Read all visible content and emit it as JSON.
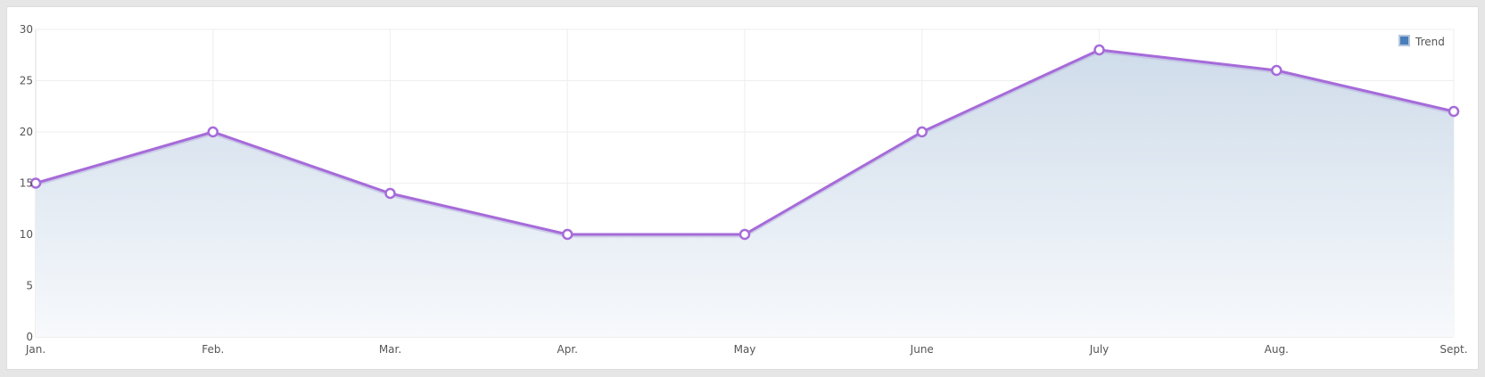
{
  "chart_data": {
    "type": "area",
    "categories": [
      "Jan.",
      "Feb.",
      "Mar.",
      "Apr.",
      "May",
      "June",
      "July",
      "Aug.",
      "Sept."
    ],
    "series": [
      {
        "name": "Trend",
        "values": [
          15,
          20,
          14,
          10,
          10,
          20,
          28,
          26,
          22
        ]
      }
    ],
    "yticks": [
      0,
      5,
      10,
      15,
      20,
      25,
      30
    ],
    "ylim": [
      0,
      30
    ],
    "grid": true,
    "legend": "top-right",
    "colors": {
      "line": "#a66bd9",
      "line_shadow": "#b9b6e0",
      "fill_top": "#cfdcea",
      "fill_bottom": "#f7f9fc",
      "legend_swatch": "#4a7ebb",
      "grid": "#eeeeee",
      "axis": "#dddddd"
    }
  }
}
